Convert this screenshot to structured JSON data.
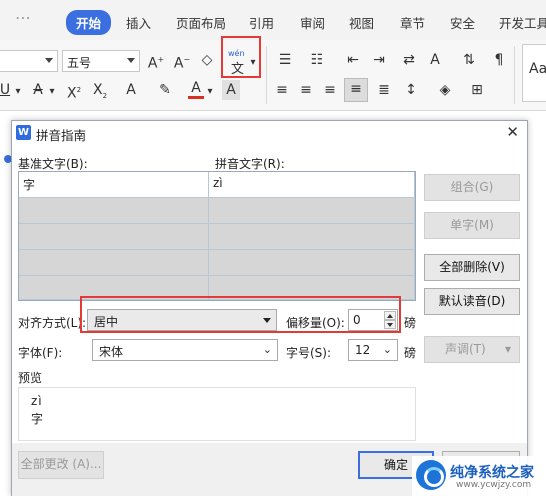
{
  "ribbon": {
    "tabs": [
      "开始",
      "插入",
      "页面布局",
      "引用",
      "审阅",
      "视图",
      "章节",
      "安全",
      "开发工具"
    ],
    "active_tab": "开始",
    "font_name": "",
    "font_size": "五号",
    "phonetic_button_top": "wén",
    "phonetic_button_char": "文",
    "styles_preview": "Aa"
  },
  "dialog": {
    "title": "拼音指南",
    "close": "✕",
    "base_text_label": "基准文字(B):",
    "ruby_text_label": "拼音文字(R):",
    "rows": [
      {
        "base": "字",
        "ruby": "zì"
      },
      {
        "base": "",
        "ruby": ""
      },
      {
        "base": "",
        "ruby": ""
      },
      {
        "base": "",
        "ruby": ""
      },
      {
        "base": "",
        "ruby": ""
      }
    ],
    "buttons": {
      "group": "组合(G)",
      "single": "单字(M)",
      "delete_all": "全部删除(V)",
      "default_reading": "默认读音(D)",
      "tone": "声调(T)",
      "change_all": "全部更改 (A)...",
      "ok": "确定"
    },
    "alignment_label": "对齐方式(L):",
    "alignment_value": "居中",
    "offset_label": "偏移量(O):",
    "offset_value": "0",
    "offset_unit": "磅",
    "font_label": "字体(F):",
    "font_value": "宋体",
    "size_label": "字号(S):",
    "size_value": "12",
    "size_unit": "磅",
    "preview_label": "预览",
    "preview_ruby": "zì",
    "preview_base": "字"
  },
  "watermark": {
    "title": "纯净系统之家",
    "url": "www.ycwjzy.com"
  },
  "colors": {
    "accent": "#3b6fe0",
    "highlight_box": "#e23b35",
    "font_color_red": "#d93025",
    "font_color_blue": "#2f5fd0"
  }
}
